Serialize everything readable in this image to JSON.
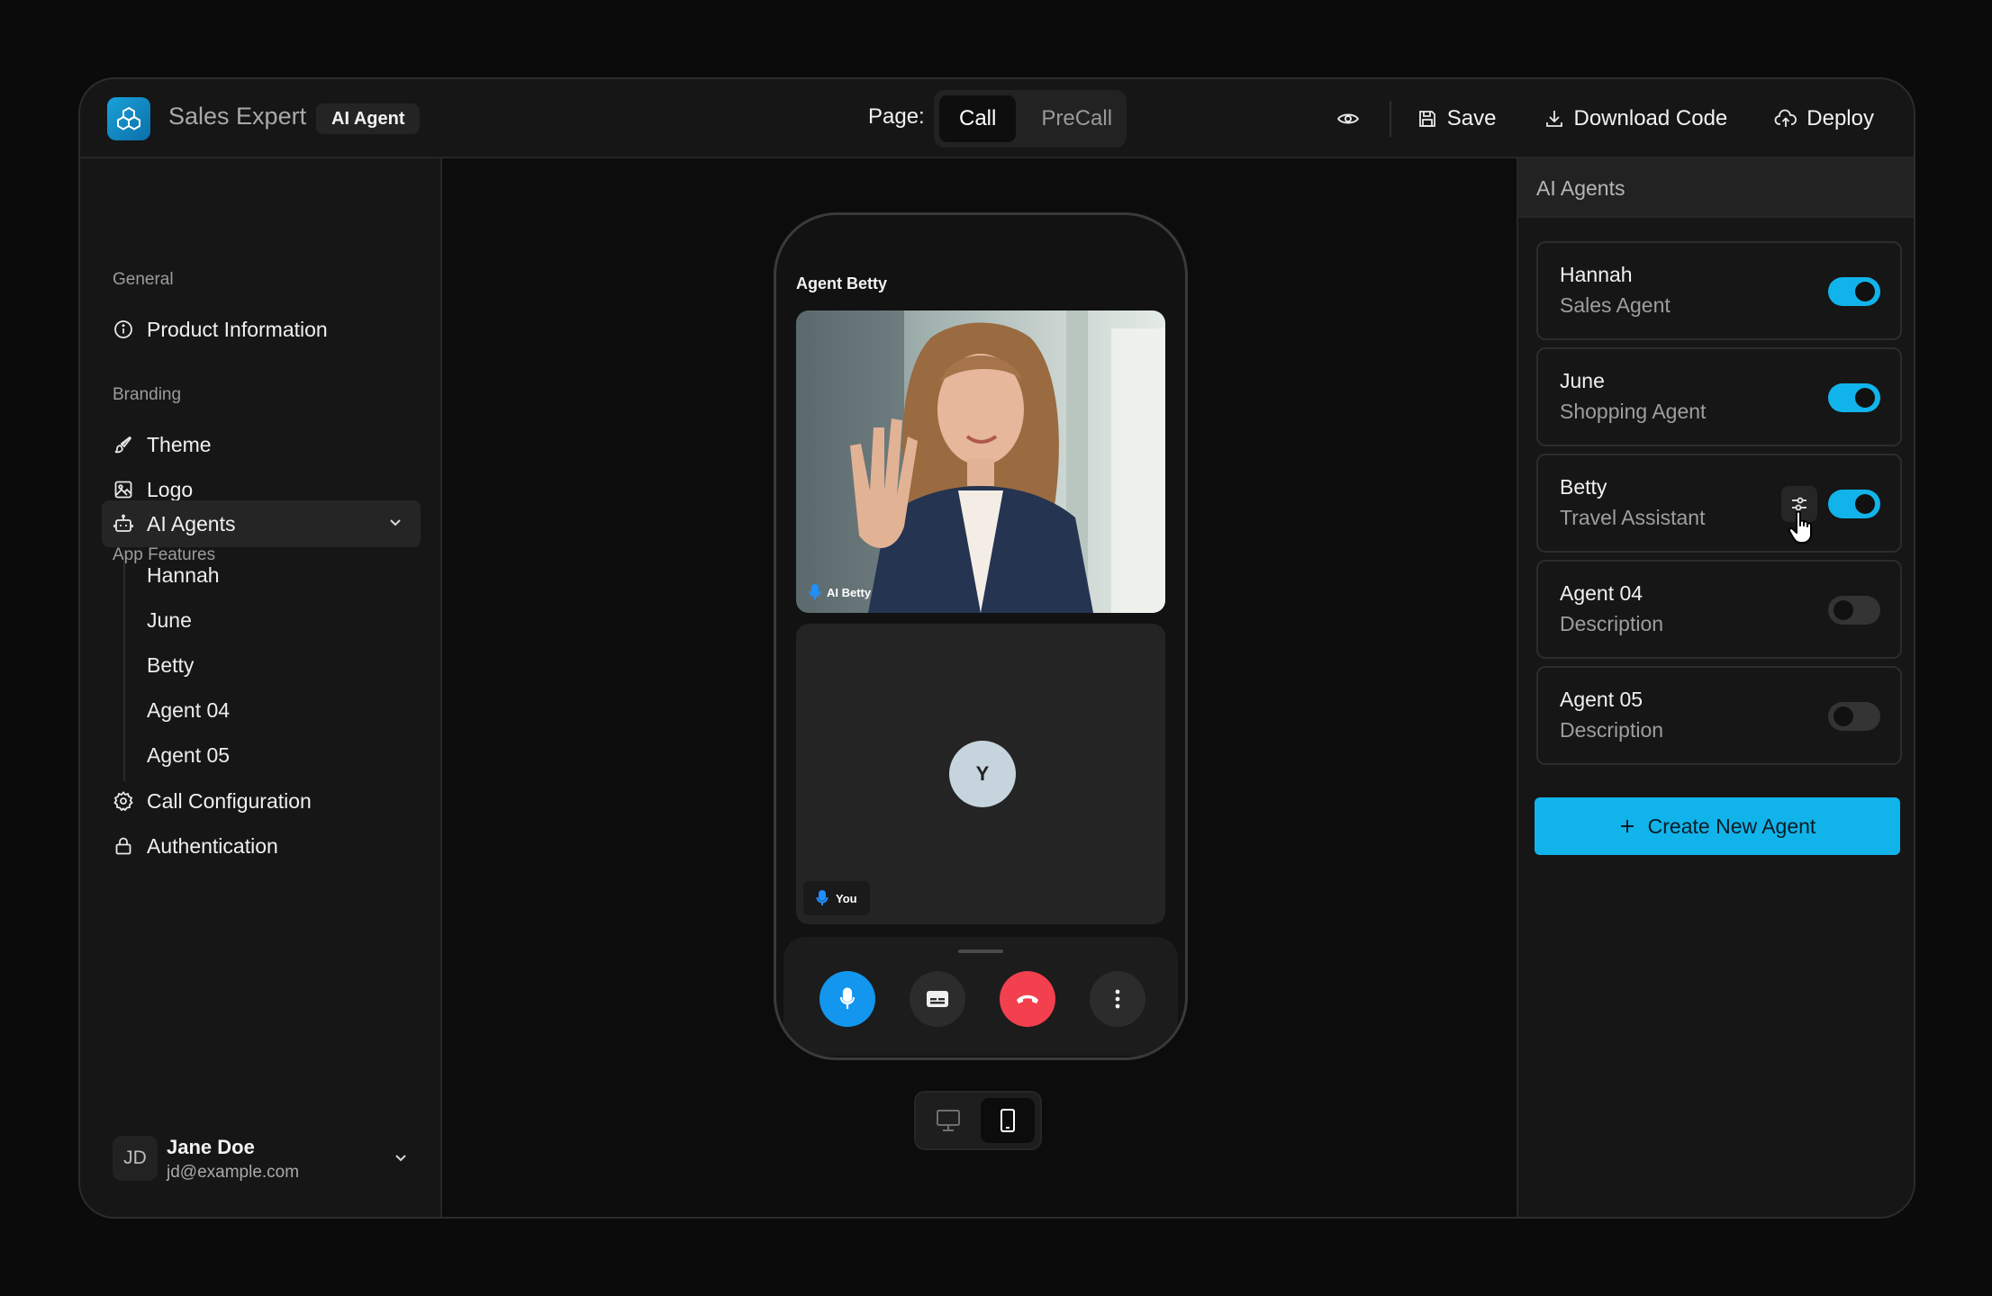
{
  "app": {
    "name": "Sales Expert",
    "mode_badge": "AI Agent"
  },
  "page_switch": {
    "label": "Page:",
    "tabs": [
      {
        "label": "Call",
        "active": true
      },
      {
        "label": "PreCall",
        "active": false
      }
    ]
  },
  "toolbar": {
    "preview_icon": "eye-icon",
    "save_label": "Save",
    "download_label": "Download Code",
    "deploy_label": "Deploy"
  },
  "sidebar": {
    "sections": {
      "general": "General",
      "branding": "Branding",
      "app_features": "App Features"
    },
    "items": {
      "product_information": "Product Information",
      "theme": "Theme",
      "logo": "Logo",
      "ai_agents": "AI Agents",
      "call_configuration": "Call Configuration",
      "authentication": "Authentication"
    },
    "agent_subitems": [
      "Hannah",
      "June",
      "Betty",
      "Agent 04",
      "Agent 05"
    ],
    "user": {
      "initials": "JD",
      "name": "Jane Doe",
      "email": "jd@example.com"
    }
  },
  "phone": {
    "title": "Agent Betty",
    "remote_label": "AI Betty",
    "self_initial": "Y",
    "self_label": "You",
    "controls": [
      "mic-icon",
      "captions-icon",
      "hang-up-icon",
      "more-icon"
    ]
  },
  "device_switch": {
    "options": [
      "desktop-icon",
      "mobile-icon"
    ],
    "selected": "mobile-icon"
  },
  "right_panel": {
    "title": "AI Agents",
    "agents": [
      {
        "name": "Hannah",
        "role": "Sales Agent",
        "enabled": true
      },
      {
        "name": "June",
        "role": "Shopping Agent",
        "enabled": true
      },
      {
        "name": "Betty",
        "role": "Travel Assistant",
        "enabled": true
      },
      {
        "name": "Agent 04",
        "role": "Description",
        "enabled": false
      },
      {
        "name": "Agent 05",
        "role": "Description",
        "enabled": false
      }
    ],
    "create_button": "Create New Agent"
  },
  "colors": {
    "accent": "#11b4ea",
    "hang_up": "#f2404e",
    "mic": "#1296ee",
    "background": "#0b0b0b"
  }
}
